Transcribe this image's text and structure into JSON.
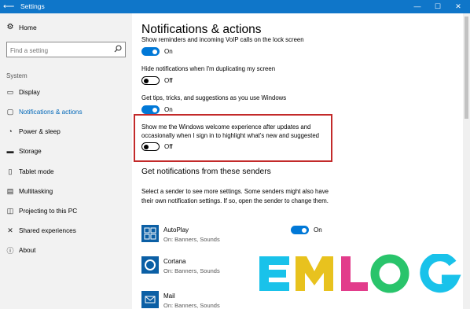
{
  "window": {
    "title": "Settings",
    "back_glyph": "⟵",
    "minimize_glyph": "—",
    "maximize_glyph": "☐",
    "close_glyph": "✕"
  },
  "sidebar": {
    "home": {
      "label": "Home",
      "icon": "gear-icon"
    },
    "search": {
      "placeholder": "Find a setting",
      "icon": "search-icon"
    },
    "section_label": "System",
    "items": [
      {
        "label": "Display",
        "icon": "display-icon"
      },
      {
        "label": "Notifications & actions",
        "icon": "notifications-icon",
        "active": true
      },
      {
        "label": "Power & sleep",
        "icon": "power-icon"
      },
      {
        "label": "Storage",
        "icon": "storage-icon"
      },
      {
        "label": "Tablet mode",
        "icon": "tablet-icon"
      },
      {
        "label": "Multitasking",
        "icon": "multitasking-icon"
      },
      {
        "label": "Projecting to this PC",
        "icon": "projecting-icon"
      },
      {
        "label": "Shared experiences",
        "icon": "shared-icon"
      },
      {
        "label": "About",
        "icon": "info-icon"
      }
    ],
    "accent_color": "#0067b8"
  },
  "main": {
    "title": "Notifications & actions",
    "settings": [
      {
        "label": "Show reminders and incoming VoIP calls on the lock screen",
        "state": "On",
        "on": true
      },
      {
        "label": "Hide notifications when I'm duplicating my screen",
        "state": "Off",
        "on": false
      },
      {
        "label": "Get tips, tricks, and suggestions as you use Windows",
        "state": "On",
        "on": true
      },
      {
        "label_line1": "Show me the Windows welcome experience after updates and",
        "label_line2": "occasionally when I sign in to highlight what's new and suggested",
        "state": "Off",
        "on": false
      }
    ],
    "senders_heading": "Get notifications from these senders",
    "senders_desc": "Select a sender to see more settings. Some senders might also have their own notification settings. If so, open the sender to change them.",
    "senders": [
      {
        "name": "AutoPlay",
        "sub": "On: Banners, Sounds",
        "state": "On",
        "icon": "autoplay-icon"
      },
      {
        "name": "Cortana",
        "sub": "On: Banners, Sounds",
        "icon": "cortana-icon"
      },
      {
        "name": "Mail",
        "sub": "On: Banners, Sounds",
        "icon": "mail-icon"
      }
    ]
  },
  "colors": {
    "titlebar": "#0f76c9",
    "toggle_on": "#0078d7",
    "highlight_border": "#c32a2a",
    "watermark": [
      "#19c2ea",
      "#e8c21e",
      "#e23c8b",
      "#29c46b",
      "#19c2ea"
    ]
  },
  "watermark": {
    "text": "EMLOG"
  }
}
